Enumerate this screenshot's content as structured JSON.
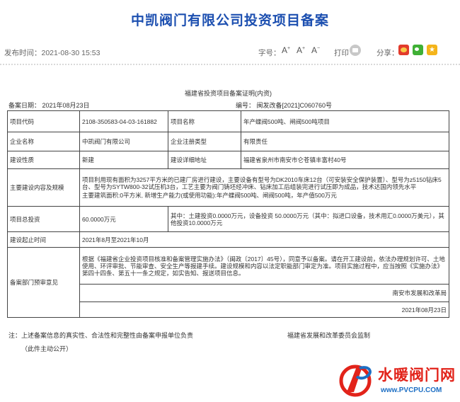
{
  "page": {
    "title": "中凯阀门有限公司投资项目备案",
    "publish_time": "发布时间：2021-08-30 15:53",
    "font_size_label": "字号：",
    "font_sizes": [
      "A",
      "A",
      "A"
    ],
    "print_label": "打印",
    "share_label": "分享：",
    "share_icons": [
      "weibo-icon",
      "wechat-icon",
      "qzone-icon"
    ]
  },
  "document": {
    "title": "福建省投资项目备案证明(内资)",
    "filing_date": "备案日期：  2021年08月23日",
    "record_no": "编号：  闽发改备[2021]C060760号",
    "rows": {
      "project_code_label": "项目代码",
      "project_code": "2108-350583-04-03-161882",
      "project_name_label": "项目名称",
      "project_name": "年产蝶阀500吨、闸阀500吨项目",
      "enterprise_name_label": "企业名称",
      "enterprise_name": "中凯阀门有限公司",
      "registration_type_label": "企业注册类型",
      "registration_type": "有限责任",
      "nature_label": "建设性质",
      "nature": "新建",
      "location_label": "建设详细地址",
      "location": "福建省泉州市南安市仑苍镇丰富村40号",
      "content_label": "主要建设内容及规模",
      "content_1": "项目利用现有面积为3257平方米的已建厂房进行建设，主要设备有型号为DK2010车床12台（可安装安全保护装置）、型号为z5150钻床5台、型号为SYTW800-32试压机3台，工艺主要为阀门铸坯经冲床、钻床加工后组装完进行试压即为成品，技术达国内领先水平",
      "content_2": "主要建筑面积:0平方米, 新增生产能力(或使用功能):年产蝶阀500吨、闸阀500吨，年产值500万元",
      "investment_label": "项目总投资",
      "investment": "60.0000万元",
      "investment_detail": "其中：土建投资0.0000万元，设备投资 50.0000万元（其中：拟进口设备，技术用汇0.0000万美元），其他投资10.0000万元",
      "period_label": "建设起止时间",
      "period": "2021年8月至2021年10月",
      "opinion_label": "备案部门预审意见",
      "opinion": "根据《福建省企业投资项目核准和备案管理实施办法》（闽政〔2017〕45号），同意予以备案。请在开工建设前，依法办理规划许可、土地使用、环评审批、节能审查、安全生产等报建手续。建设规模和内容以法定职能部门审定为准。项目实施过程中，应当按照《实施办法》第四十四条、第五十一条之规定，如实告知、报送项目信息。",
      "authority": "南安市发展和改革局",
      "authority_date": "2021年08月23日"
    },
    "footnote": "注：上述备案信息的真实性、合法性和完整性由备案申报单位负责",
    "supervision": "福建省发展和改革委员会监制",
    "public_note": "（此件主动公开）"
  },
  "watermark": {
    "brand": "水暖阀门网",
    "url": "www.PVCPU.COM"
  },
  "colors": {
    "title": "#1c4fb0",
    "watermark_red": "#e2231a",
    "watermark_blue": "#1d6fc4",
    "border": "#444444"
  }
}
